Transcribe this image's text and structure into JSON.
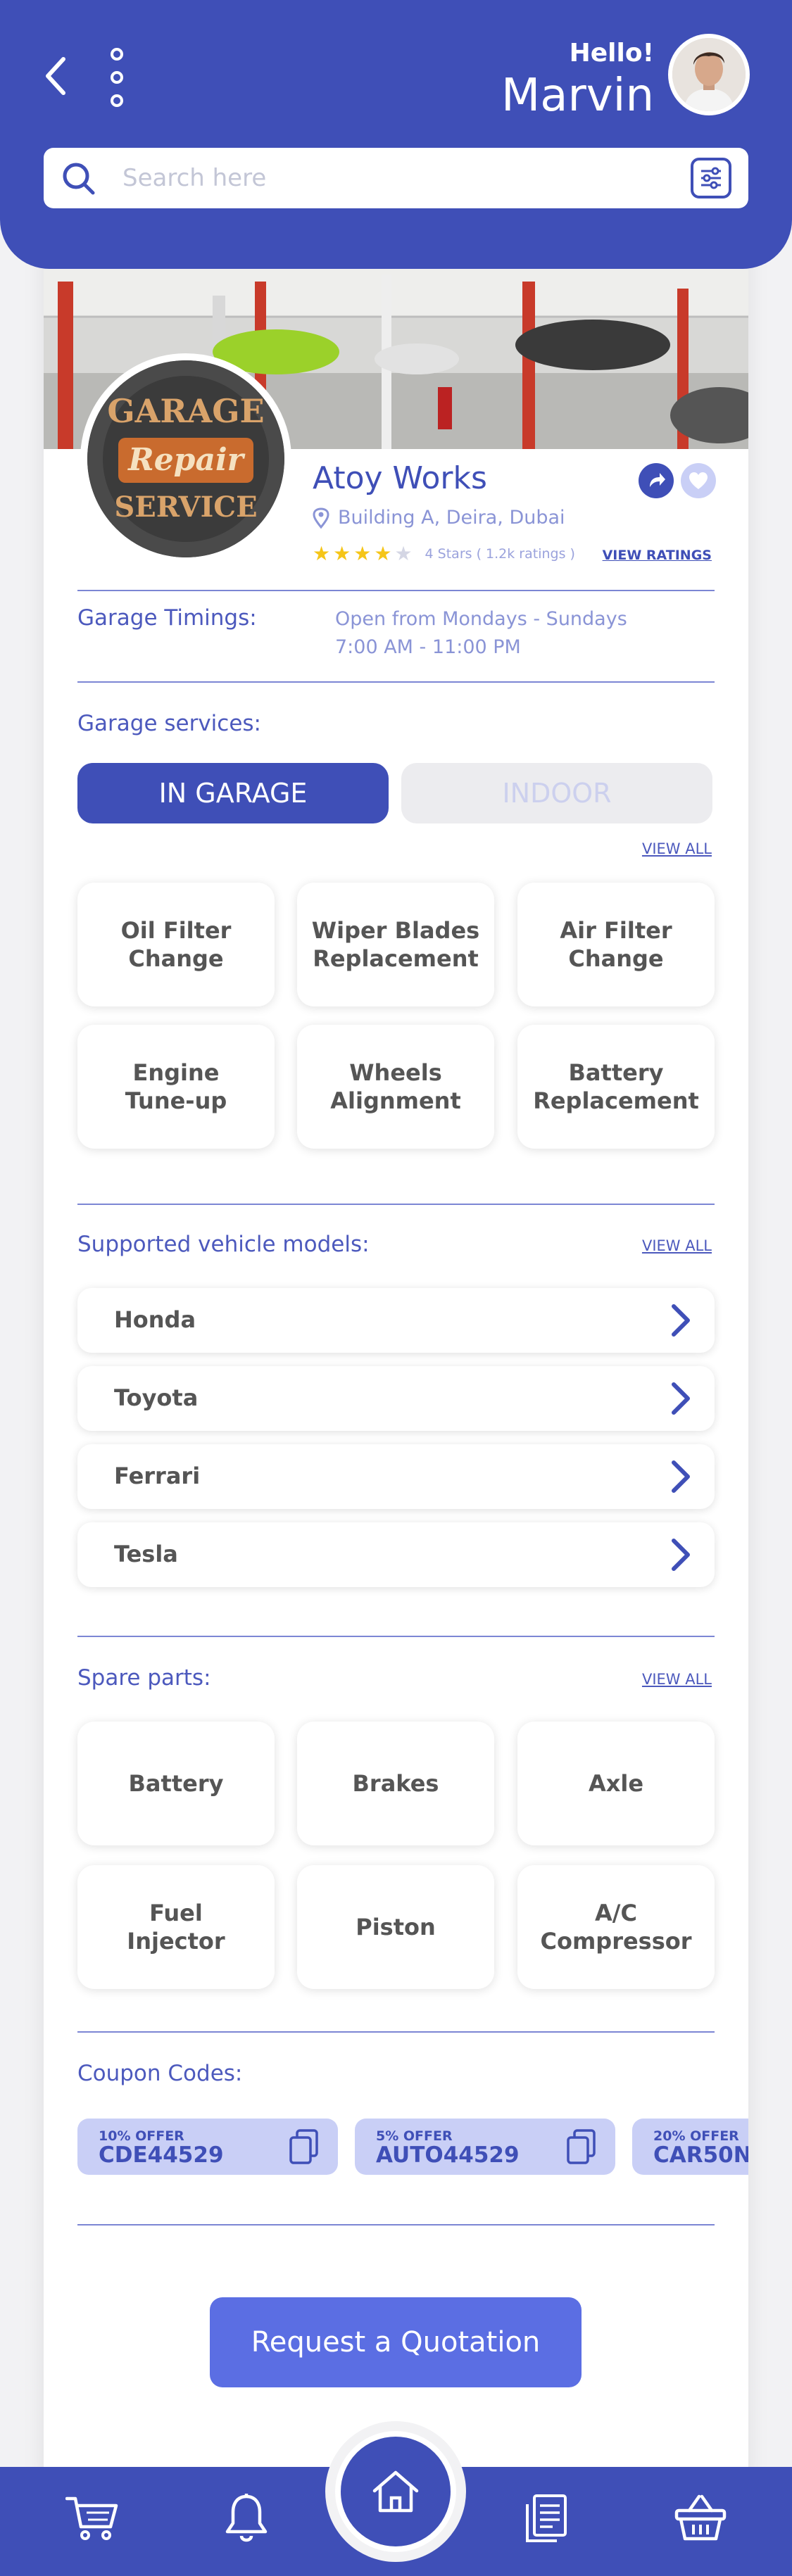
{
  "header": {
    "greeting": "Hello!",
    "user_name": "Marvin",
    "search_placeholder": "Search here"
  },
  "garage": {
    "name": "Atoy Works",
    "address": "Building A, Deira, Dubai",
    "rating": 4,
    "rating_text": "4 Stars ( 1.2k ratings )",
    "view_ratings": "VIEW RATINGS",
    "logo": {
      "top": "GARAGE",
      "middle": "Repair",
      "bottom": "SERVICE"
    }
  },
  "timings": {
    "label": "Garage Timings:",
    "line1": "Open from Mondays - Sundays",
    "line2": "7:00 AM - 11:00 PM"
  },
  "services": {
    "title": "Garage services:",
    "tabs": [
      "IN GARAGE",
      "INDOOR"
    ],
    "view_all": "VIEW ALL",
    "items": [
      [
        "Oil Filter",
        "Change"
      ],
      [
        "Wiper Blades",
        "Replacement"
      ],
      [
        "Air Filter",
        "Change"
      ],
      [
        "Engine",
        "Tune-up"
      ],
      [
        "Wheels",
        "Alignment"
      ],
      [
        "Battery",
        "Replacement"
      ]
    ]
  },
  "vehicles": {
    "title": "Supported vehicle models:",
    "view_all": "VIEW ALL",
    "items": [
      "Honda",
      "Toyota",
      "Ferrari",
      "Tesla"
    ]
  },
  "spare_parts": {
    "title": "Spare parts:",
    "view_all": "VIEW ALL",
    "items": [
      [
        "Battery",
        ""
      ],
      [
        "Brakes",
        ""
      ],
      [
        "Axle",
        ""
      ],
      [
        "Fuel",
        "Injector"
      ],
      [
        "Piston",
        ""
      ],
      [
        "A/C",
        "Compressor"
      ]
    ]
  },
  "coupons": {
    "title": "Coupon Codes:",
    "items": [
      {
        "offer": "10% OFFER",
        "code": "CDE44529"
      },
      {
        "offer": "5% OFFER",
        "code": "AUTO44529"
      },
      {
        "offer": "20% OFFER",
        "code": "CAR50N"
      }
    ]
  },
  "cta": {
    "label": "Request a Quotation"
  },
  "colors": {
    "primary": "#3f4fb7",
    "accent": "#5b6ee3",
    "light": "#c9cff6",
    "star": "#f5c518"
  },
  "icons": [
    "back-icon",
    "kebab-menu-icon",
    "search-icon",
    "filter-icon",
    "share-icon",
    "heart-icon",
    "location-pin-icon",
    "star-icon",
    "chevron-right-icon",
    "copy-icon",
    "cart-icon",
    "bell-icon",
    "home-icon",
    "document-icon",
    "basket-icon"
  ]
}
